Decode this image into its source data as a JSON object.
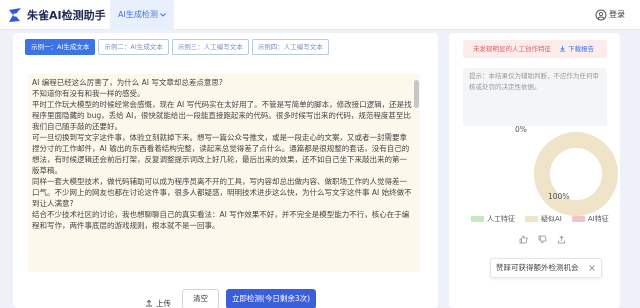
{
  "header": {
    "app_title": "朱雀AI检测助手",
    "nav_tab": "AI生成检测",
    "login": "登录"
  },
  "examples": {
    "tabs": [
      {
        "label": "示例一：AI生成文本",
        "active": true
      },
      {
        "label": "示例二：AI生成文本",
        "active": false
      },
      {
        "label": "示例三：人工编写文本",
        "active": false
      },
      {
        "label": "示例四：人工编写文本",
        "active": false
      }
    ]
  },
  "editor": {
    "paragraphs": [
      "AI 编程已经这么厉害了，为什么 AI 写文章却总差点意思?",
      "不知道你有没有和我一样的感受。",
      "平时工作玩大模型的时候经常会感慨，现在 AI 写代码实在太好用了。不管是写简单的脚本，修改接口逻辑，还是找程序里面隐藏的 bug，丢给 AI，很快就能给出一段能直接跑起来的代码。很多时候写出来的代码，规范程度甚至比我们自己随手敲的还要好。",
      "可一旦切换到写文字这件事，体验立刻就掉下来。想写一篇公众号推文，或是一段走心的文案，又或者一封需要拿捏分寸的工作邮件，AI 输出的东西看着结构完整，读起来总觉得差了点什么。通篇都是很规整的套话，没有自己的想法，有时候逻辑还会前后打架，反复调整提示词改上好几轮，最后出来的效果，还不如自己坐下来敲出来的第一版草稿。",
      "同样一套大模型技术，做代码辅助可以成为程序员离不开的工具，写内容却总出做内容、做职场工作的人觉得差一口气。不少网上的网友也都在讨论这件事，很多人都疑惑，明明技术进步这么快，为什么写文字这件事 AI 始终做不到让人满意?",
      "结合不少技术社区的讨论，我也想聊聊自己的真实看法：AI 写作效果不好，并不完全是模型能力不行，核心在于编程和写作，两件事底层的游戏规则，根本就不是一回事。"
    ]
  },
  "actions": {
    "upload": "上传",
    "clear": "清空",
    "detect": "立即检测(今日剩余3次)"
  },
  "result": {
    "warning": "未发现明显的人工创作特征",
    "download": "下载报告",
    "tip": "提示：本结果仅为辅助判断，不应作为任何审核或处罚的决定性依据。",
    "pct_low_label": "0%",
    "pct_high_label": "100%",
    "promo": "赞踩可获得额外检测机会"
  },
  "chart_data": {
    "type": "pie",
    "categories": [
      "人工特征",
      "疑似AI",
      "AI特征"
    ],
    "values": [
      0,
      100,
      0
    ],
    "colors": [
      "#c5e8c3",
      "#efe3c8",
      "#f4c4c4"
    ],
    "legend_position": "bottom"
  },
  "colors": {
    "accent": "#3b74e6",
    "detect_button": "#3b5fd9",
    "warning_text": "#e35a5a"
  },
  "icons": {
    "logo": "zhuque-logo-icon",
    "login": "user-icon",
    "upload": "upload-icon",
    "download": "download-icon",
    "like": "thumb-up-icon",
    "dislike": "thumb-down-icon",
    "share": "share-icon",
    "close": "close-icon"
  }
}
